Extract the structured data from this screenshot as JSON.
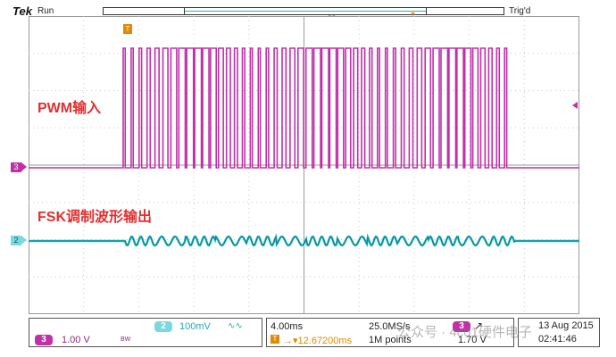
{
  "header": {
    "brand": "Tek",
    "run_state": "Run",
    "trigger_state": "Trig'd",
    "trigger_marker": "T"
  },
  "waveforms": {
    "pwm_label": "PWM输入",
    "fsk_label": "FSK调制波形输出",
    "ch3_marker": "3",
    "ch2_marker": "2",
    "colors": {
      "ch3": "#c030a8",
      "ch2": "#1fb7c4",
      "grid": "#9a9a9a",
      "label": "#e03030"
    }
  },
  "readout": {
    "ch2_badge": "2",
    "ch2_scale": "100mV",
    "ch2_coupling_icon": "ac-wave-icon",
    "ch3_badge": "3",
    "ch3_scale": "1.00 V",
    "ch3_bw": "BW",
    "timebase": "4.00ms",
    "sample_rate": "25.0MS/s",
    "trigger_source_badge": "3",
    "trigger_edge": "rising-edge-icon",
    "trigger_marker": "T",
    "trigger_delay": "12.67200ms",
    "record_length": "1M points",
    "trigger_level": "1.70 V",
    "date": "13 Aug 2015",
    "time": "02:41:46"
  },
  "watermark": "公众号 · 4c01硬件电子"
}
